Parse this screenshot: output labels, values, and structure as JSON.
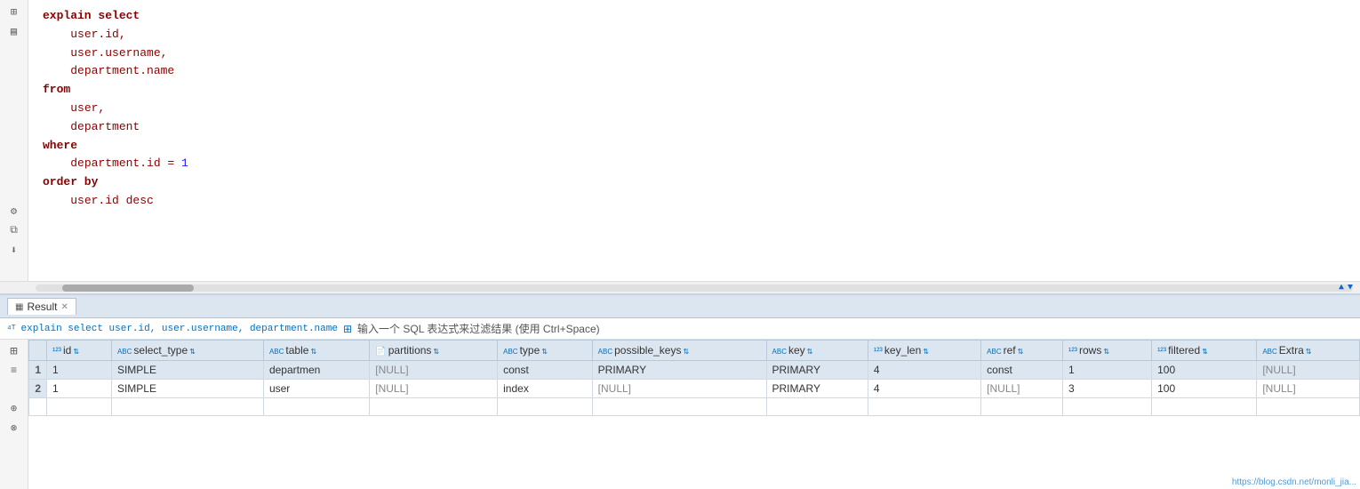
{
  "editor": {
    "code_lines": [
      {
        "tokens": [
          {
            "text": "explain select",
            "cls": "kw"
          }
        ]
      },
      {
        "tokens": [
          {
            "text": "    user.id,",
            "cls": "field"
          }
        ]
      },
      {
        "tokens": [
          {
            "text": "    user.username,",
            "cls": "field"
          }
        ]
      },
      {
        "tokens": [
          {
            "text": "    department.name",
            "cls": "field"
          }
        ]
      },
      {
        "tokens": [
          {
            "text": "from",
            "cls": "kw"
          }
        ]
      },
      {
        "tokens": [
          {
            "text": "    user,",
            "cls": "field"
          }
        ]
      },
      {
        "tokens": [
          {
            "text": "    department",
            "cls": "field"
          }
        ]
      },
      {
        "tokens": [
          {
            "text": "where",
            "cls": "kw"
          }
        ]
      },
      {
        "tokens": [
          {
            "text": "    department.id = ",
            "cls": "field"
          },
          {
            "text": "1",
            "cls": "num"
          }
        ]
      },
      {
        "tokens": [
          {
            "text": "order by",
            "cls": "kw"
          }
        ]
      },
      {
        "tokens": [
          {
            "text": "    user.id desc",
            "cls": "field"
          }
        ]
      }
    ]
  },
  "result_panel": {
    "tab_label": "Result",
    "tab_close": "✕",
    "query_display": "explain select user.id, user.username, department.name",
    "filter_hint": "输入一个 SQL 表达式来过滤结果 (使用 Ctrl+Space)",
    "columns": [
      {
        "icon": "123",
        "label": "id",
        "sort": true
      },
      {
        "icon": "ABC",
        "label": "select_type",
        "sort": true
      },
      {
        "icon": "ABC",
        "label": "table",
        "sort": true
      },
      {
        "icon": "📄",
        "label": "partitions",
        "sort": true
      },
      {
        "icon": "ABC",
        "label": "type",
        "sort": true
      },
      {
        "icon": "ABC",
        "label": "possible_keys",
        "sort": true
      },
      {
        "icon": "ABC",
        "label": "key",
        "sort": true
      },
      {
        "icon": "123",
        "label": "key_len",
        "sort": true
      },
      {
        "icon": "ABC",
        "label": "ref",
        "sort": true
      },
      {
        "icon": "123",
        "label": "rows",
        "sort": true
      },
      {
        "icon": "123",
        "label": "filtered",
        "sort": true
      },
      {
        "icon": "ABC",
        "label": "Extra",
        "sort": true
      }
    ],
    "rows": [
      {
        "row_num": "1",
        "id": "1",
        "select_type": "SIMPLE",
        "table": "departmen",
        "partitions": "[NULL]",
        "type": "const",
        "possible_keys": "PRIMARY",
        "key": "PRIMARY",
        "key_len": "4",
        "ref": "const",
        "rows": "1",
        "filtered": "100",
        "extra": "[NULL]",
        "highlighted": true
      },
      {
        "row_num": "2",
        "id": "1",
        "select_type": "SIMPLE",
        "table": "user",
        "partitions": "[NULL]",
        "type": "index",
        "possible_keys": "[NULL]",
        "key": "PRIMARY",
        "key_len": "4",
        "ref": "[NULL]",
        "rows": "3",
        "filtered": "100",
        "extra": "[NULL]",
        "highlighted": false
      }
    ]
  },
  "watermark": "https://blog.csdn.net/monli_jia..."
}
